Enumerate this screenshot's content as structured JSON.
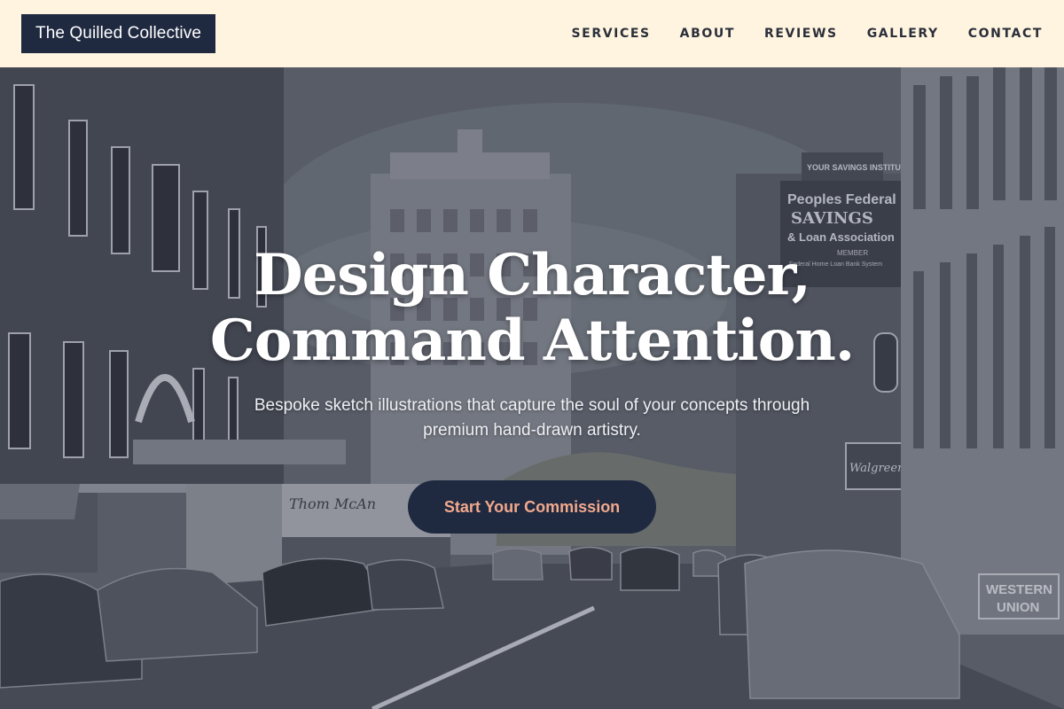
{
  "brand": {
    "name": "The Quilled Collective"
  },
  "nav": {
    "items": [
      {
        "label": "SERVICES"
      },
      {
        "label": "ABOUT"
      },
      {
        "label": "REVIEWS"
      },
      {
        "label": "GALLERY"
      },
      {
        "label": "CONTACT"
      }
    ]
  },
  "hero": {
    "headline_line1": "Design Character,",
    "headline_line2": "Command Attention.",
    "subhead": "Bespoke sketch illustrations that capture the soul of your concepts through premium hand-drawn artistry.",
    "cta_label": "Start Your Commission"
  },
  "scene_signs": {
    "savings_top": "YOUR SAVINGS INSTITUTION",
    "savings_line1": "Peoples Federal",
    "savings_line2": "SAVINGS",
    "savings_line3": "& Loan Association",
    "savings_member": "MEMBER",
    "savings_small": "Federal Home Loan Bank System",
    "western1": "WESTERN",
    "western2": "UNION",
    "walgreens": "Walgreen Co",
    "shoe_store": "Thom McAn"
  },
  "colors": {
    "header_bg": "#fff4e0",
    "brand_bg": "#1f2940",
    "cta_bg": "#1f2940",
    "cta_text": "#f2a98c",
    "nav_text": "#2a2f3a"
  }
}
